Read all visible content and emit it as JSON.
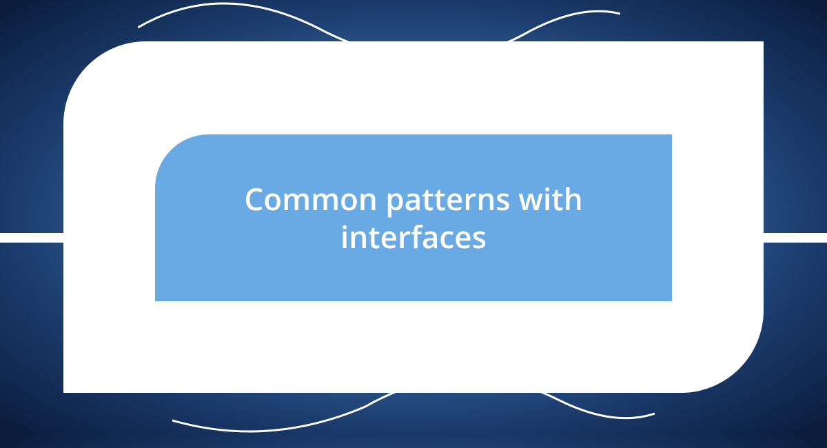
{
  "card": {
    "title": "Common patterns with interfaces"
  }
}
